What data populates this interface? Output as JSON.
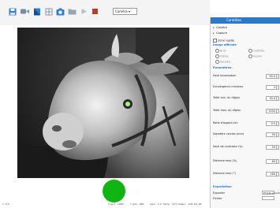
{
  "toolbar": {
    "icons": [
      "save-icon",
      "record-video-icon",
      "flag-icon",
      "grid-icon",
      "camera-icon",
      "folder-icon",
      "play-icon",
      "stop-icon"
    ],
    "source_select": "Caméra ▾"
  },
  "camera": {
    "status_color": "#10b511"
  },
  "statusbar": {
    "left": "x: 0.0",
    "items": [
      "X (px) : 1080",
      "Y (px) : 960",
      "Gain : 1.0",
      "Temp : 32°C",
      "Valeur : 128, 64, 64"
    ]
  },
  "panel": {
    "title": "Contrôles",
    "expanders": [
      "Caméra",
      "Capture"
    ],
    "live_label": "Zone rapide",
    "image_section": "Image affichée",
    "radios": [
      "Brut",
      "Calibrée",
      "Filtrée",
      "Fusion",
      "Sauvée"
    ],
    "params_section": "Paramètres",
    "fields": [
      {
        "label": "Seuil binarisation",
        "value": "50.0"
      },
      {
        "label": "Convergence min/max",
        "value": "3"
      },
      {
        "label": "Taille min. du région",
        "value": "50.0"
      },
      {
        "label": "Taille max. du région",
        "value": "1000"
      },
      {
        "label": "Ratio d'aspect min",
        "value": "0.5"
      },
      {
        "label": "Diamètre cercles (mm)",
        "value": "50"
      },
      {
        "label": "Seuil de contraste (%)",
        "value": "50"
      },
      {
        "label": "Distance max (%)",
        "value": "60"
      },
      {
        "label": "Distance max (°)",
        "value": "180"
      }
    ],
    "export_section": "Exportation",
    "export_rows": [
      {
        "label": "Exporter",
        "value": "Emplacement"
      },
      {
        "label": "Fichier",
        "value": ""
      }
    ]
  }
}
